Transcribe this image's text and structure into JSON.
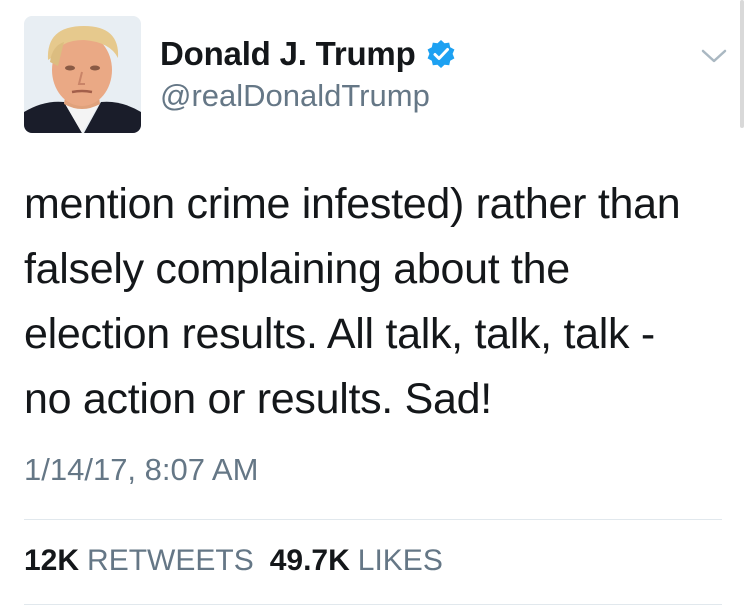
{
  "author": {
    "display_name": "Donald J. Trump",
    "handle": "@realDonaldTrump",
    "verified": true,
    "verified_badge_icon": "verified-badge-icon",
    "avatar_icon": "profile-photo-avatar"
  },
  "menu": {
    "icon": "chevron-down-icon"
  },
  "tweet": {
    "lines": [
      "mention crime infested) rather than",
      "falsely complaining about the",
      "election results. All talk, talk, talk -",
      "no action or results. Sad!"
    ],
    "timestamp": "1/14/17, 8:07 AM"
  },
  "stats": {
    "retweets_count": "12K",
    "retweets_label": "RETWEETS",
    "likes_count": "49.7K",
    "likes_label": "LIKES"
  },
  "colors": {
    "text_primary": "#14171a",
    "text_secondary": "#657786",
    "verified_blue": "#1da1f2",
    "divider": "#e1e8ed"
  }
}
